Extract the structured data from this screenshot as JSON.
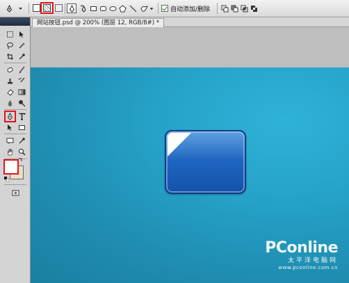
{
  "options_bar": {
    "auto_add_delete": "自动添加/删除",
    "icons": [
      "pen-tool-icon",
      "shape-layers-icon",
      "paths-icon",
      "fill-pixels-icon",
      "pen-icon",
      "freeform-pen-icon",
      "rectangle-icon",
      "rounded-rectangle-icon",
      "ellipse-icon",
      "polygon-icon",
      "line-icon",
      "custom-shape-icon",
      "dropdown-arrow-icon",
      "add-shape-area-icon",
      "subtract-area-icon",
      "intersect-area-icon",
      "exclude-overlap-icon"
    ]
  },
  "document": {
    "tab_title": "网站按钮.psd @ 200% (图层 12, RGB/8#) *"
  },
  "watermark": {
    "brand": "PConline",
    "tagline": "太平洋电脑网",
    "url": "www.pconline.com.cn"
  },
  "colors": {
    "canvas_top": "#2fb2d8",
    "canvas_bottom": "#1b7fa2",
    "button_blue": "#1f66c2",
    "highlight_red": "#e0141e",
    "foreground": "#ffffff",
    "background": "#e8dfc4"
  }
}
